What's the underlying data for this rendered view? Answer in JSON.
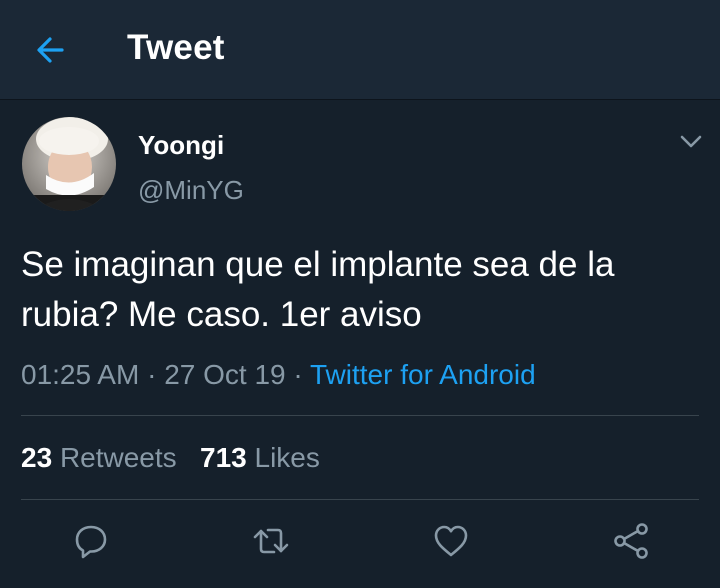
{
  "header": {
    "title": "Tweet",
    "back_icon": "arrow-left-icon"
  },
  "tweet": {
    "author": {
      "display_name": "Yoongi",
      "handle": "@MinYG",
      "avatar": "avatar-photo"
    },
    "text": "Se imaginan que el implante sea de la rubia? Me caso. 1er aviso",
    "time": "01:25 AM",
    "date": "27 Oct 19",
    "separator": "·",
    "source": "Twitter for Android"
  },
  "stats": {
    "retweets_count": "23",
    "retweets_label": "Retweets",
    "likes_count": "713",
    "likes_label": "Likes"
  },
  "actions": [
    "reply-icon",
    "retweet-icon",
    "like-icon",
    "share-icon"
  ],
  "colors": {
    "background": "#15202b",
    "header": "#1b2836",
    "accent": "#1da1f2",
    "secondary_text": "#8899a6",
    "divider": "#38444d"
  }
}
